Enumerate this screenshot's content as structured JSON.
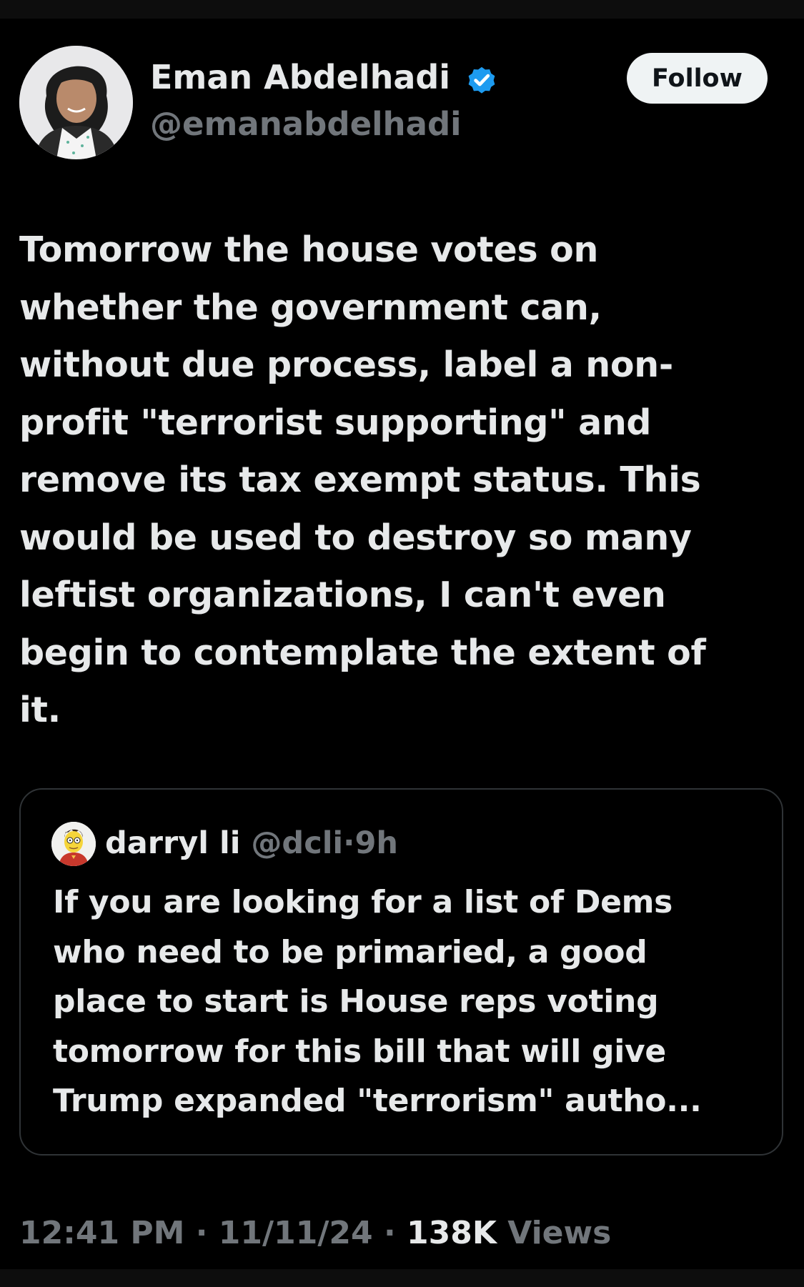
{
  "author": {
    "name": "Eman Abdelhadi",
    "handle": "@emanabdelhadi",
    "verified_color": "#1d9bf0"
  },
  "follow_label": "Follow",
  "tweet_lines": [
    "Tomorrow the house votes on",
    "whether the government can,",
    "without due process, label a non-",
    "profit \"terrorist supporting\" and",
    "remove its tax exempt status. This",
    "would be used to destroy so many",
    "leftist organizations, I can't even",
    "begin to contemplate the extent of",
    "it."
  ],
  "quote": {
    "name": "darryl li",
    "handle": "@dcli",
    "separator": "·",
    "time": "9h",
    "lines": [
      "If you are looking for a list of Dems",
      "who need to be primaried, a good",
      "place to start is House reps voting",
      "tomorrow for this bill that will give",
      "Trump expanded \"terrorism\" autho..."
    ]
  },
  "meta": {
    "time": "12:41 PM",
    "sep1": "·",
    "date": "11/11/24",
    "sep2": "·",
    "views_count": "138K",
    "views_label": "Views"
  },
  "colors": {
    "background": "#000000",
    "text": "#e7e9ea",
    "secondary": "#71767b",
    "border": "#2f3336",
    "follow_bg": "#eff3f4"
  }
}
